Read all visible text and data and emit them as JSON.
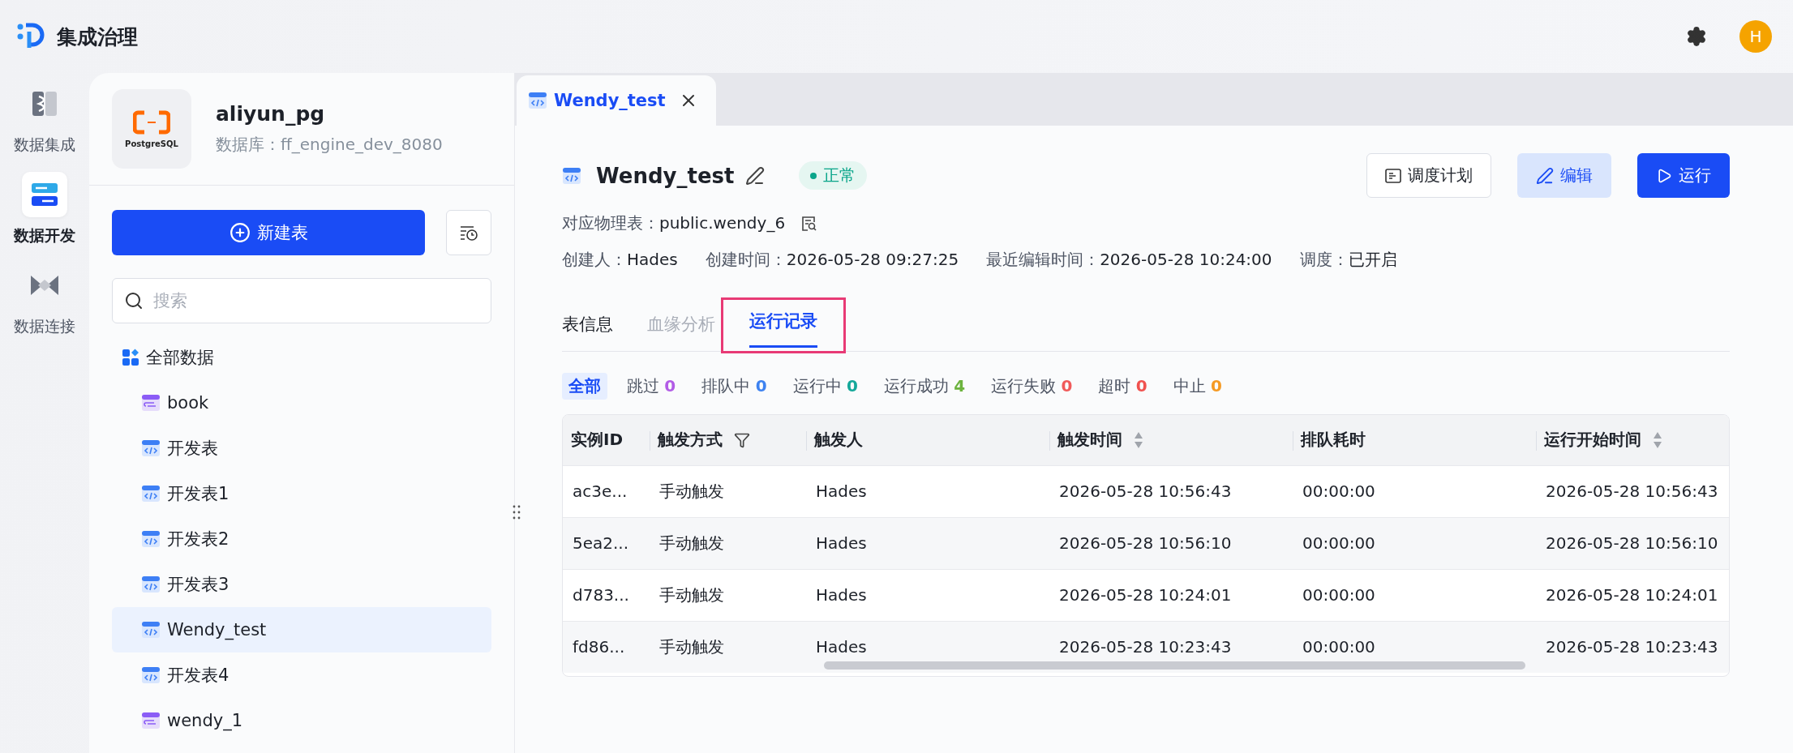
{
  "app": {
    "title": "集成治理",
    "avatar": "H"
  },
  "rail": [
    {
      "label": "数据集成",
      "kind": "integration",
      "selected": false
    },
    {
      "label": "数据开发",
      "kind": "develop",
      "selected": true
    },
    {
      "label": "数据连接",
      "kind": "connect",
      "selected": false
    }
  ],
  "source": {
    "name": "aliyun_pg",
    "logo_text": "PostgreSQL",
    "database": "数据库：ff_engine_dev_8080"
  },
  "new_button": "新建表",
  "search": {
    "placeholder": "搜索"
  },
  "tree": {
    "label": "全部数据",
    "children": [
      {
        "label": "book",
        "kind": "table",
        "selected": false
      },
      {
        "label": "开发表",
        "kind": "dev",
        "selected": false
      },
      {
        "label": "开发表1",
        "kind": "dev",
        "selected": false
      },
      {
        "label": "开发表2",
        "kind": "dev",
        "selected": false
      },
      {
        "label": "开发表3",
        "kind": "dev",
        "selected": false
      },
      {
        "label": "Wendy_test",
        "kind": "dev",
        "selected": true
      },
      {
        "label": "开发表4",
        "kind": "dev",
        "selected": false
      },
      {
        "label": "wendy_1",
        "kind": "table",
        "selected": false
      }
    ]
  },
  "tabs": [
    {
      "label": "Wendy_test",
      "selected": true
    }
  ],
  "detail": {
    "title": "Wendy_test",
    "status": "正常",
    "buttons": [
      {
        "label": "调度计划",
        "kind": "schedule"
      },
      {
        "label": "编辑",
        "kind": "edit"
      },
      {
        "label": "运行",
        "kind": "run"
      }
    ],
    "physical_table": {
      "label": "对应物理表：",
      "value": "public.wendy_6"
    },
    "meta": [
      {
        "label": "创建人：",
        "value": "Hades"
      },
      {
        "label": "创建时间：",
        "value": "2026-05-28 09:27:25"
      },
      {
        "label": "最近编辑时间：",
        "value": "2026-05-28 10:24:00"
      },
      {
        "label": "调度：",
        "value": "已开启"
      }
    ]
  },
  "sections": [
    {
      "label": "表信息",
      "selected": false,
      "disabled": false,
      "highlighted": false
    },
    {
      "label": "血缘分析",
      "selected": false,
      "disabled": true,
      "highlighted": false
    },
    {
      "label": "运行记录",
      "selected": true,
      "disabled": false,
      "highlighted": true
    }
  ],
  "filters": [
    {
      "label": "全部",
      "selected": true
    },
    {
      "label": "跳过",
      "count": "0",
      "color": "#b25ce6",
      "selected": false
    },
    {
      "label": "排队中",
      "count": "0",
      "color": "#3d82f0",
      "selected": false
    },
    {
      "label": "运行中",
      "count": "0",
      "color": "#14a89a",
      "selected": false
    },
    {
      "label": "运行成功",
      "count": "4",
      "color": "#6cb33e",
      "selected": false
    },
    {
      "label": "运行失败",
      "count": "0",
      "color": "#f05a5a",
      "selected": false
    },
    {
      "label": "超时",
      "count": "0",
      "color": "#f0524f",
      "selected": false
    },
    {
      "label": "中止",
      "count": "0",
      "color": "#f59a23",
      "selected": false
    }
  ],
  "table": {
    "columns": [
      {
        "label": "实例ID",
        "filter": false,
        "sortable": false
      },
      {
        "label": "触发方式",
        "filter": true,
        "sortable": false
      },
      {
        "label": "触发人",
        "filter": false,
        "sortable": false
      },
      {
        "label": "触发时间",
        "filter": false,
        "sortable": true
      },
      {
        "label": "排队耗时",
        "filter": false,
        "sortable": false
      },
      {
        "label": "运行开始时间",
        "filter": false,
        "sortable": true
      }
    ],
    "rows": [
      [
        "ac3e...",
        "手动触发",
        "Hades",
        "2026-05-28 10:56:43",
        "00:00:00",
        "2026-05-28 10:56:43"
      ],
      [
        "5ea2...",
        "手动触发",
        "Hades",
        "2026-05-28 10:56:10",
        "00:00:00",
        "2026-05-28 10:56:10"
      ],
      [
        "d783...",
        "手动触发",
        "Hades",
        "2026-05-28 10:24:01",
        "00:00:00",
        "2026-05-28 10:24:01"
      ],
      [
        "fd86...",
        "手动触发",
        "Hades",
        "2026-05-28 10:23:43",
        "00:00:00",
        "2026-05-28 10:23:43"
      ]
    ]
  }
}
